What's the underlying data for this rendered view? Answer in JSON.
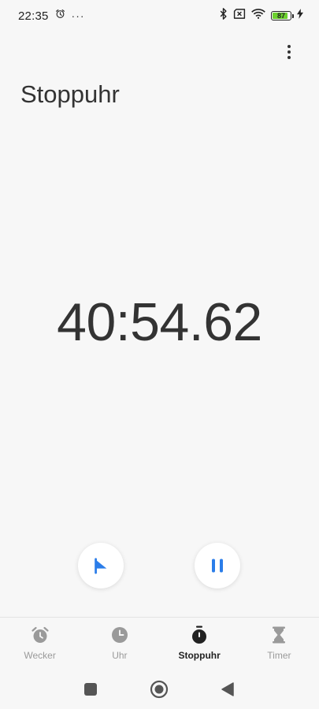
{
  "status_bar": {
    "time": "22:35",
    "more_indicator": "···",
    "battery_level": "87",
    "battery_fraction": 0.87,
    "battery_color": "#6cd12e"
  },
  "header": {
    "title": "Stoppuhr"
  },
  "stopwatch": {
    "elapsed": "40:54.62"
  },
  "actions": {
    "lap_icon": "flag-icon",
    "pause_icon": "pause-icon",
    "accent_color": "#2b7de9"
  },
  "bottom_nav": {
    "items": [
      {
        "label": "Wecker",
        "icon": "alarm-clock-icon",
        "active": false
      },
      {
        "label": "Uhr",
        "icon": "clock-icon",
        "active": false
      },
      {
        "label": "Stoppuhr",
        "icon": "stopwatch-icon",
        "active": true
      },
      {
        "label": "Timer",
        "icon": "hourglass-icon",
        "active": false
      }
    ]
  },
  "system_nav": {
    "buttons": [
      "recents-icon",
      "home-icon",
      "back-icon"
    ]
  }
}
